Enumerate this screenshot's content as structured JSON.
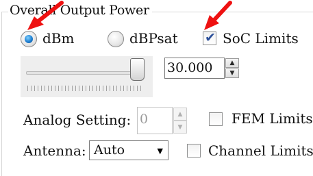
{
  "group": {
    "title": "Overall Output Power"
  },
  "units": [
    {
      "label": "dBm",
      "checked": true
    },
    {
      "label": "dBPsat",
      "checked": false
    }
  ],
  "soc_limits": {
    "label": "SoC Limits",
    "checked": true
  },
  "power": {
    "value": "30.000",
    "slider_level": 1.0
  },
  "analog": {
    "label": "Analog Setting:",
    "value": "0",
    "enabled": false
  },
  "fem_limits": {
    "label": "FEM Limits",
    "checked": false
  },
  "antenna": {
    "label": "Antenna:",
    "value": "Auto"
  },
  "channel_limits": {
    "label": "Channel Limits",
    "checked": false
  },
  "icons": {
    "check": "✔",
    "spin_up": "▲",
    "spin_down": "▼",
    "dropdown": "▼"
  },
  "colors": {
    "accent_red": "#ee1111",
    "radio_blue": "#1f7fd0"
  }
}
